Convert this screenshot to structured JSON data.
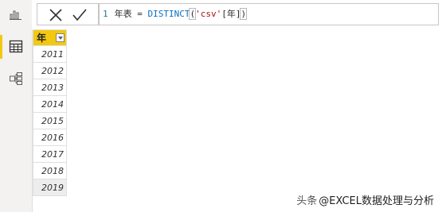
{
  "left_rail": {
    "items": [
      {
        "name": "report-view",
        "icon": "bar-chart-icon",
        "active": false
      },
      {
        "name": "data-view",
        "icon": "table-grid-icon",
        "active": true
      },
      {
        "name": "model-view",
        "icon": "model-diagram-icon",
        "active": false
      }
    ]
  },
  "formula_bar": {
    "line_number": "1",
    "table_name": "年表",
    "equals": "=",
    "function": "DISTINCT",
    "open_paren": "(",
    "source_table": "'csv'",
    "column_ref": "[年]",
    "close_paren": ")"
  },
  "table": {
    "column_header": "年",
    "rows": [
      "2011",
      "2012",
      "2013",
      "2014",
      "2015",
      "2016",
      "2017",
      "2018",
      "2019"
    ],
    "selected_row_index": 8
  },
  "watermark": {
    "prefix": "头条",
    "text": "@EXCEL数据处理与分析"
  },
  "colors": {
    "accent": "#f2c811",
    "function": "#0b6fbf",
    "string": "#a31515"
  }
}
